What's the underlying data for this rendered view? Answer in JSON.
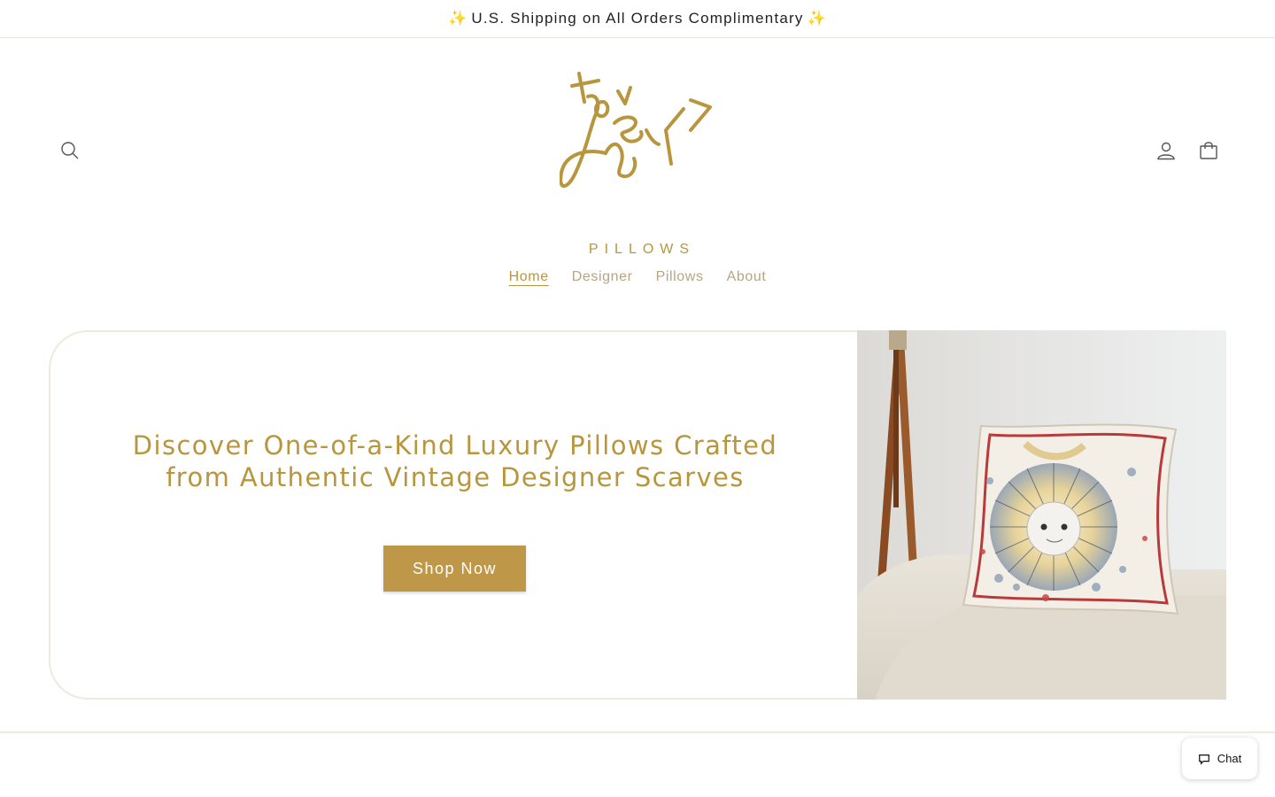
{
  "announcement": {
    "sparkle_left": "✨",
    "text": "U.S. Shipping on All Orders Complimentary",
    "sparkle_right": "✨"
  },
  "header": {
    "logo_subtitle": "PILLOWS",
    "icons": {
      "search": "search-icon",
      "account": "account-icon",
      "cart": "cart-icon"
    }
  },
  "nav": {
    "items": [
      {
        "label": "Home",
        "active": true
      },
      {
        "label": "Designer",
        "active": false
      },
      {
        "label": "Pillows",
        "active": false
      },
      {
        "label": "About",
        "active": false
      }
    ]
  },
  "hero": {
    "heading": "Discover One-of-a-Kind Luxury Pillows Crafted from Authentic Vintage Designer Scarves",
    "button_label": "Shop Now"
  },
  "chat": {
    "label": "Chat"
  },
  "colors": {
    "brand_gold": "#b8963e",
    "button_gold": "#bf9748",
    "nav_muted": "#b8a580",
    "border": "#efe9df"
  }
}
